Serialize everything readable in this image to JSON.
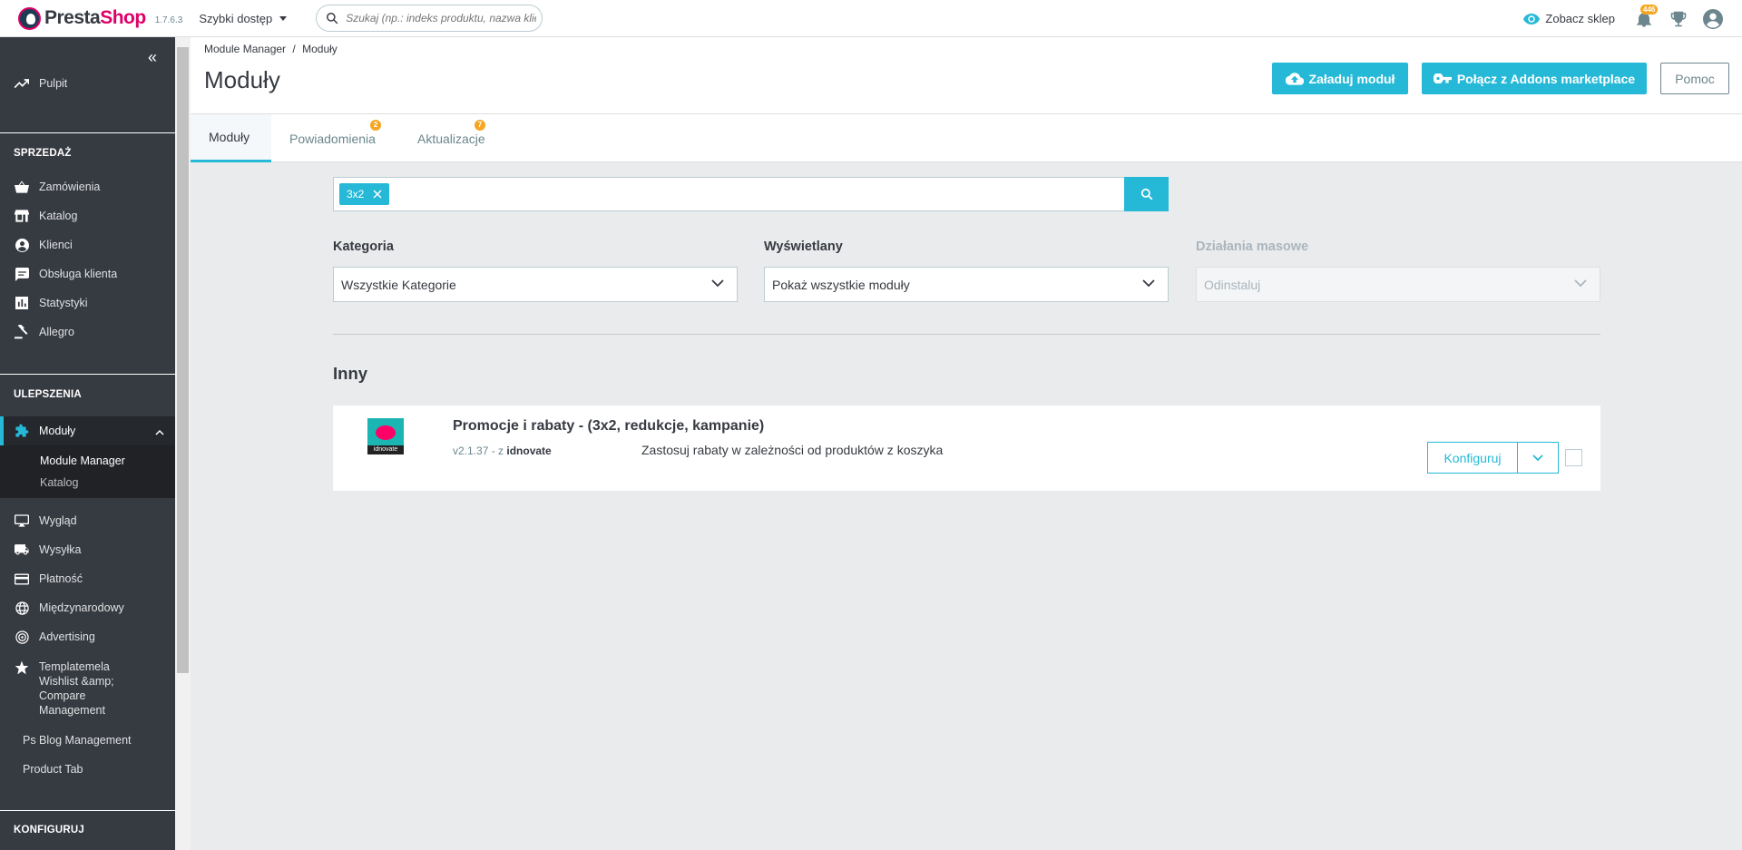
{
  "header": {
    "logo_part1": "Presta",
    "logo_part2": "Shop",
    "version": "1.7.6.3",
    "quick_access": "Szybki dostęp",
    "search_placeholder": "Szukaj (np.: indeks produktu, nazwa klie",
    "view_shop": "Zobacz sklep",
    "notifications_count": "446"
  },
  "sidebar": {
    "dashboard": "Pulpit",
    "section_sell": "SPRZEDAŻ",
    "sell_items": [
      "Zamówienia",
      "Katalog",
      "Klienci",
      "Obsługa klienta",
      "Statystyki",
      "Allegro"
    ],
    "section_improve": "ULEPSZENIA",
    "modules": "Moduły",
    "modules_sub": [
      "Module Manager",
      "Katalog"
    ],
    "improve_items": [
      "Wygląd",
      "Wysyłka",
      "Płatność",
      "Międzynarodowy",
      "Advertising"
    ],
    "templatemela": "Templatemela Wishlist &amp; Compare Management",
    "blog": "Ps Blog Management",
    "product_tab": "Product Tab",
    "section_configure": "KONFIGURUJ"
  },
  "page": {
    "breadcrumb_1": "Module Manager",
    "breadcrumb_sep": "/",
    "breadcrumb_2": "Moduły",
    "title": "Moduły",
    "upload_button": "Załaduj moduł",
    "connect_button": "Połącz z Addons marketplace",
    "help_button": "Pomoc"
  },
  "tabs": [
    {
      "label": "Moduły",
      "badge": ""
    },
    {
      "label": "Powiadomienia",
      "badge": "2"
    },
    {
      "label": "Aktualizacje",
      "badge": "7"
    }
  ],
  "filters": {
    "search_tag": "3x2",
    "category_label": "Kategoria",
    "category_value": "Wszystkie Kategorie",
    "status_label": "Wyświetlany",
    "status_value": "Pokaż wszystkie moduły",
    "bulk_label": "Działania masowe",
    "bulk_value": "Odinstaluj"
  },
  "group": {
    "title": "Inny"
  },
  "module": {
    "name": "Promocje i rabaty - (3x2, redukcje, kampanie)",
    "version": "v2.1.37 - z",
    "author": "idnovate",
    "description": "Zastosuj rabaty w zależności od produktów z koszyka",
    "configure_button": "Konfiguruj",
    "logo_brand": "idnovate"
  },
  "colors": {
    "accent": "#25b9d7",
    "sidebar_bg": "#363a41",
    "badge": "#f5a623",
    "brand_pink": "#df0067"
  }
}
